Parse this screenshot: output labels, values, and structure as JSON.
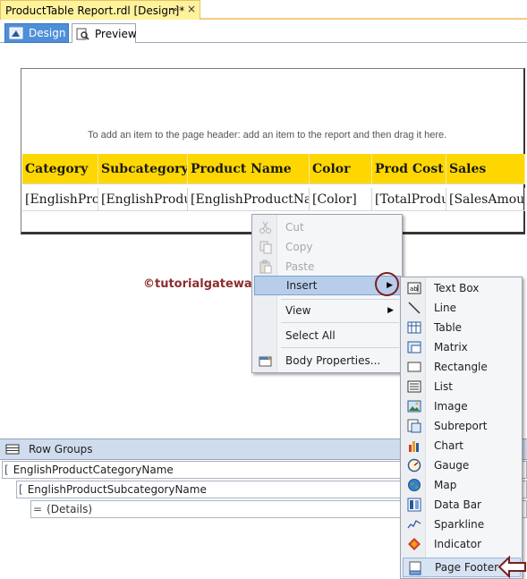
{
  "document_tab": {
    "title": "ProductTable Report.rdl [Design]*",
    "pin_glyph": "⊸",
    "close_glyph": "×"
  },
  "view_tabs": [
    {
      "label": "Design",
      "icon": "design-icon",
      "active": true
    },
    {
      "label": "Preview",
      "icon": "preview-icon",
      "active": false
    }
  ],
  "report": {
    "header_hint": "To add an item to the page header: add an item to the report and then drag it here.",
    "columns": [
      "Category",
      "Subcategory",
      "Product Name",
      "Color",
      "Prod Cost",
      "Sales"
    ],
    "row": [
      "[EnglishPro",
      "[EnglishProdu",
      "[EnglishProductNa",
      "[Color]",
      "[TotalProdu",
      "[SalesAmou"
    ],
    "header_color": "#ffd700"
  },
  "watermark": "©tutorialgateway.org",
  "context_menu": {
    "items": [
      {
        "label": "Cut",
        "icon": "cut-icon",
        "enabled": false
      },
      {
        "label": "Copy",
        "icon": "copy-icon",
        "enabled": false
      },
      {
        "label": "Paste",
        "icon": "paste-icon",
        "enabled": false
      },
      {
        "label": "Insert",
        "icon": "",
        "enabled": true,
        "submenu": true,
        "highlighted": true
      },
      {
        "label": "View",
        "icon": "",
        "enabled": true,
        "submenu": true
      },
      {
        "label": "Select All",
        "icon": "",
        "enabled": true
      },
      {
        "label": "Body Properties...",
        "icon": "properties-icon",
        "enabled": true
      }
    ]
  },
  "insert_submenu": {
    "items": [
      {
        "label": "Text Box",
        "icon": "textbox-icon"
      },
      {
        "label": "Line",
        "icon": "line-icon"
      },
      {
        "label": "Table",
        "icon": "table-icon"
      },
      {
        "label": "Matrix",
        "icon": "matrix-icon"
      },
      {
        "label": "Rectangle",
        "icon": "rectangle-icon"
      },
      {
        "label": "List",
        "icon": "list-icon"
      },
      {
        "label": "Image",
        "icon": "image-icon"
      },
      {
        "label": "Subreport",
        "icon": "subreport-icon"
      },
      {
        "label": "Chart",
        "icon": "chart-icon"
      },
      {
        "label": "Gauge",
        "icon": "gauge-icon"
      },
      {
        "label": "Map",
        "icon": "map-icon"
      },
      {
        "label": "Data Bar",
        "icon": "databar-icon"
      },
      {
        "label": "Sparkline",
        "icon": "sparkline-icon"
      },
      {
        "label": "Indicator",
        "icon": "indicator-icon"
      },
      {
        "label": "Page Footer",
        "icon": "page-footer-icon",
        "highlighted": true
      }
    ]
  },
  "row_groups": {
    "title": "Row Groups",
    "groups": [
      "EnglishProductCategoryName",
      "EnglishProductSubcategoryName",
      "(Details)"
    ],
    "bracket": "[",
    "details_prefix": "="
  },
  "colors": {
    "accent": "#4f8fd8",
    "highlight_circle": "#7b1e1e",
    "menu_hover": "#b7cdea"
  }
}
